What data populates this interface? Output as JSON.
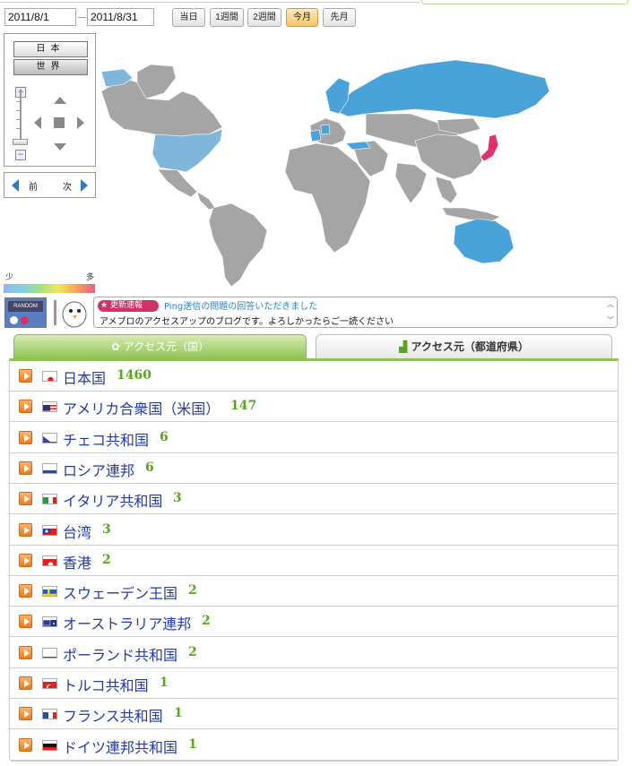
{
  "date_range": {
    "start": "2011/8/1",
    "end": "2011/8/31"
  },
  "period_buttons": [
    {
      "label": "当日",
      "selected": false
    },
    {
      "label": "1週間",
      "selected": false
    },
    {
      "label": "2週間",
      "selected": false
    },
    {
      "label": "今月",
      "selected": true
    },
    {
      "label": "先月",
      "selected": false
    }
  ],
  "region_buttons": {
    "japan": "日本",
    "world": "世界"
  },
  "nav": {
    "prev": "前",
    "next": "次"
  },
  "legend": {
    "low": "少",
    "high": "多"
  },
  "random_label": "RANDOM",
  "news": {
    "badge": "更新速報",
    "headline": "Ping送信の問題の回答いただきました",
    "body": "アメブロのアクセスアップのブログです。よろしかったらご一読ください"
  },
  "tabs": {
    "country": "アクセス元（国）",
    "prefecture": "アクセス元（都道府県）"
  },
  "colors": {
    "accent_green": "#8fc452",
    "count_green": "#5aa51e",
    "link_blue": "#233aa8",
    "map_gray": "#a5a5a5",
    "map_blue": "#4aa3d8",
    "map_lightblue": "#7fb6d9",
    "map_pink": "#e0336c"
  },
  "countries": [
    {
      "name": "日本国",
      "count": "1460",
      "flag": "jp"
    },
    {
      "name": "アメリカ合衆国（米国）",
      "count": "147",
      "flag": "us"
    },
    {
      "name": "チェコ共和国",
      "count": "6",
      "flag": "cz"
    },
    {
      "name": "ロシア連邦",
      "count": "6",
      "flag": "ru"
    },
    {
      "name": "イタリア共和国",
      "count": "3",
      "flag": "it"
    },
    {
      "name": "台湾",
      "count": "3",
      "flag": "tw"
    },
    {
      "name": "香港",
      "count": "2",
      "flag": "hk"
    },
    {
      "name": "スウェーデン王国",
      "count": "2",
      "flag": "se"
    },
    {
      "name": "オーストラリア連邦",
      "count": "2",
      "flag": "au"
    },
    {
      "name": "ポーランド共和国",
      "count": "2",
      "flag": "pl"
    },
    {
      "name": "トルコ共和国",
      "count": "1",
      "flag": "tr"
    },
    {
      "name": "フランス共和国",
      "count": "1",
      "flag": "fr"
    },
    {
      "name": "ドイツ連邦共和国",
      "count": "1",
      "flag": "de"
    }
  ]
}
